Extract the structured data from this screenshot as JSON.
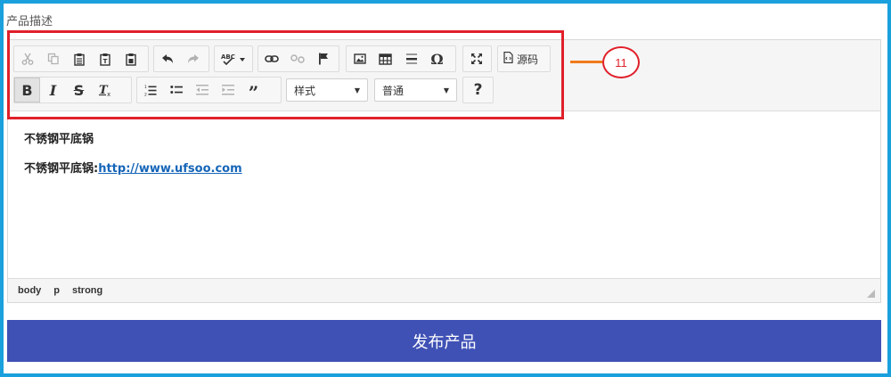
{
  "field": {
    "label": "产品描述"
  },
  "toolbar": {
    "source_label": "源码",
    "style_combo": "样式",
    "format_combo": "普通"
  },
  "callout": {
    "number": "11"
  },
  "content": {
    "line1": "不锈钢平底锅",
    "line2_prefix": "不锈钢平底锅:",
    "line2_link": "http://www.ufsoo.com"
  },
  "statusbar": {
    "path": [
      "body",
      "p",
      "strong"
    ]
  },
  "publish": {
    "label": "发布产品"
  },
  "colors": {
    "frame": "#1aa0dc",
    "highlight": "#e0202a",
    "callout_line": "#f07b1d",
    "publish_bg": "#3f51b5",
    "link": "#1565b8"
  },
  "icons": [
    "cut-icon",
    "copy-icon",
    "paste-icon",
    "paste-text-icon",
    "paste-word-icon",
    "undo-icon",
    "redo-icon",
    "spellcheck-icon",
    "link-icon",
    "unlink-icon",
    "anchor-icon",
    "image-icon",
    "table-icon",
    "horizontal-rule-icon",
    "special-char-icon",
    "maximize-icon",
    "source-icon",
    "bold-icon",
    "italic-icon",
    "strike-icon",
    "remove-format-icon",
    "numbered-list-icon",
    "bulleted-list-icon",
    "outdent-icon",
    "indent-icon",
    "blockquote-icon",
    "help-icon"
  ]
}
